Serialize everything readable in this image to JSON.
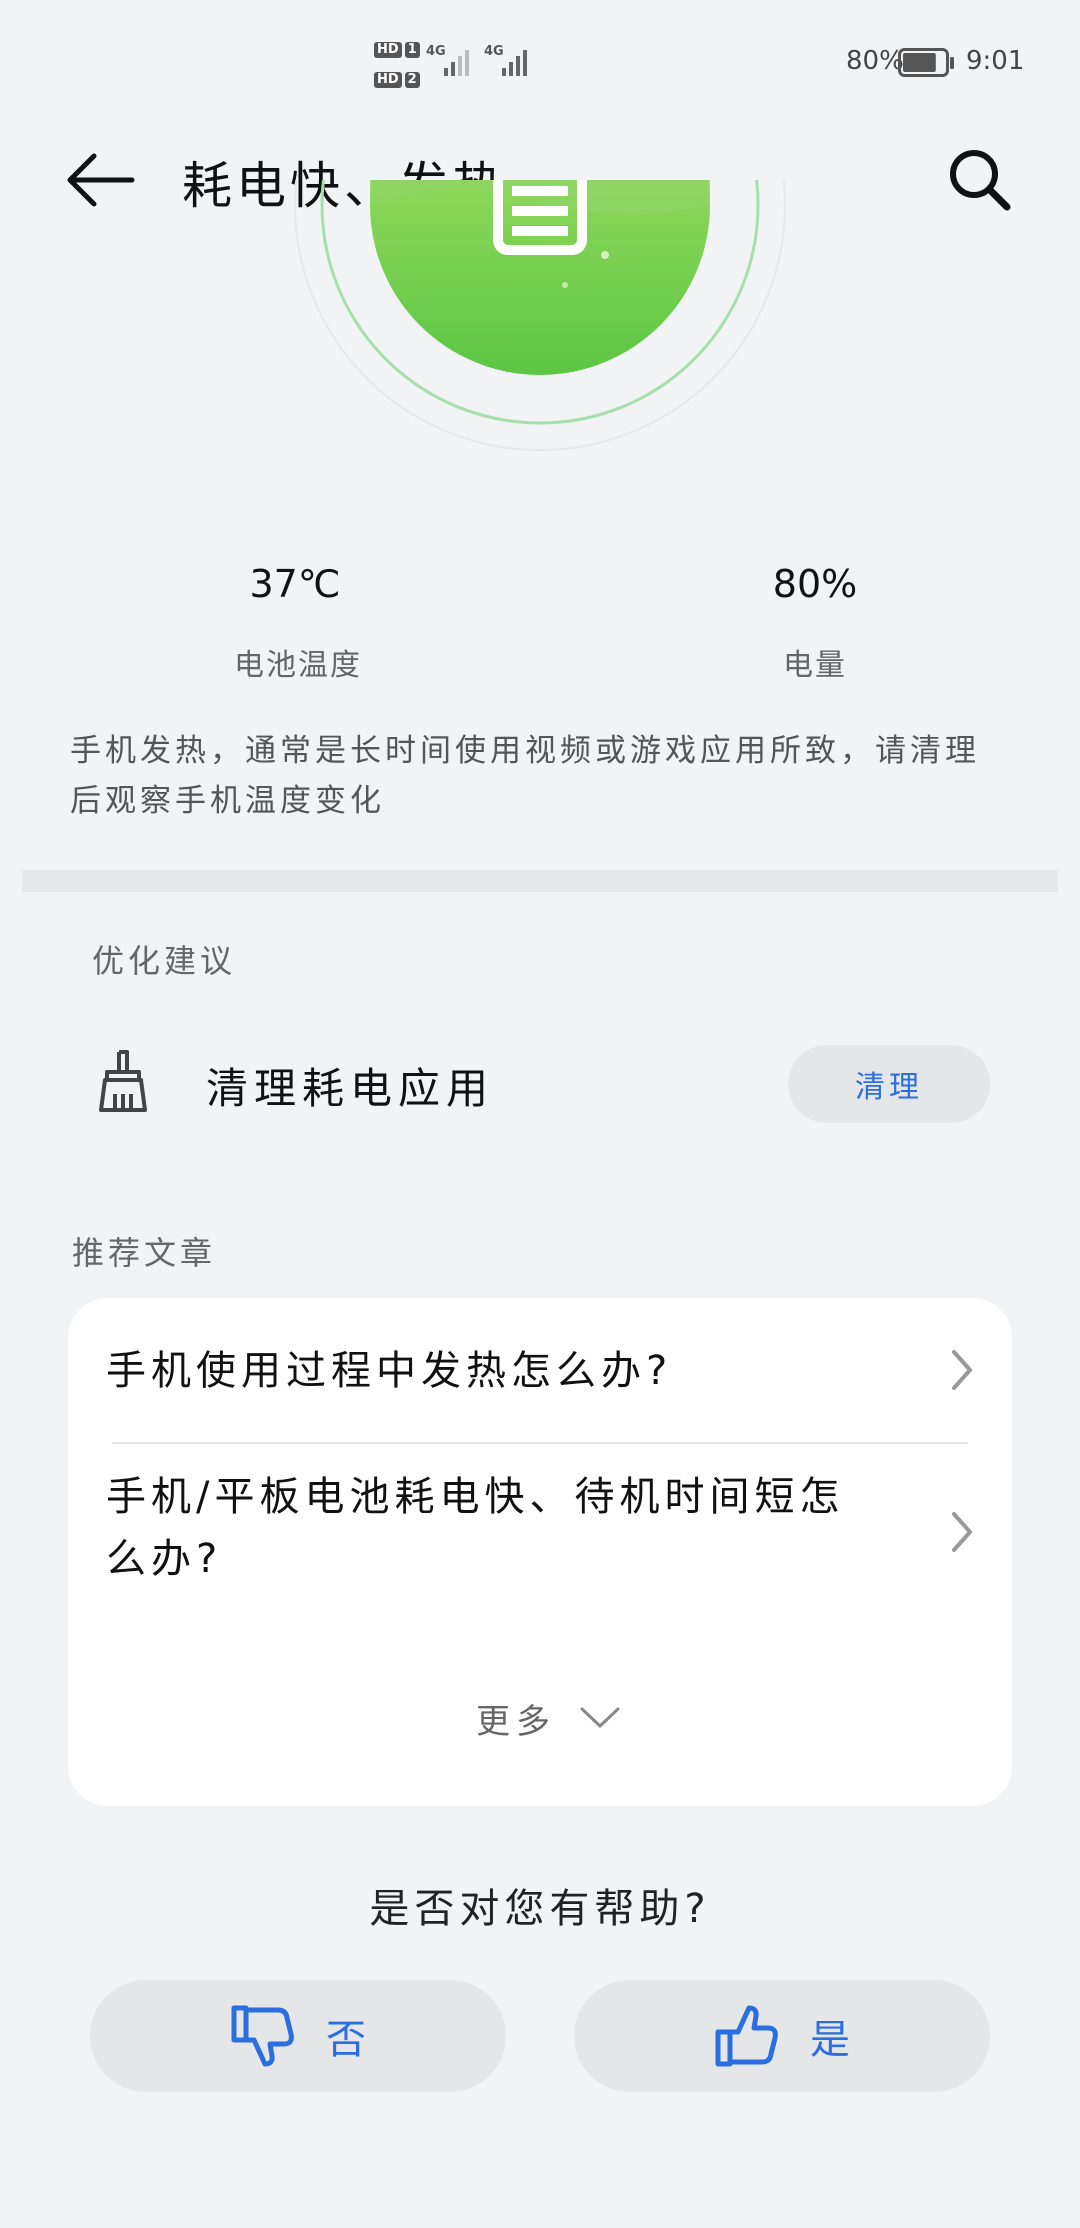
{
  "status_bar": {
    "hd1": "HD",
    "sim1": "1",
    "hd2": "HD",
    "sim2": "2",
    "net1": "4G",
    "net2": "4G",
    "battery_text": "80%",
    "battery_level": 0.8,
    "time": "9:01"
  },
  "header": {
    "title": "耗电快、发热"
  },
  "stats": {
    "temperature_value": "37℃",
    "temperature_label": "电池温度",
    "charge_value": "80%",
    "charge_label": "电量"
  },
  "description": "手机发热，通常是长时间使用视频或游戏应用所致，请清理后观察手机温度变化",
  "optimization": {
    "section_title": "优化建议",
    "item_label": "清理耗电应用",
    "button_label": "清理"
  },
  "articles": {
    "section_title": "推荐文章",
    "items": [
      {
        "title": "手机使用过程中发热怎么办?"
      },
      {
        "title": "手机/平板电池耗电快、待机时间短怎么办?"
      }
    ],
    "more_label": "更多"
  },
  "feedback": {
    "question": "是否对您有帮助?",
    "no_label": "否",
    "yes_label": "是"
  },
  "colors": {
    "accent": "#2a6ee0",
    "gauge_green": "#6ccb4a",
    "background": "#f1f3f5"
  }
}
